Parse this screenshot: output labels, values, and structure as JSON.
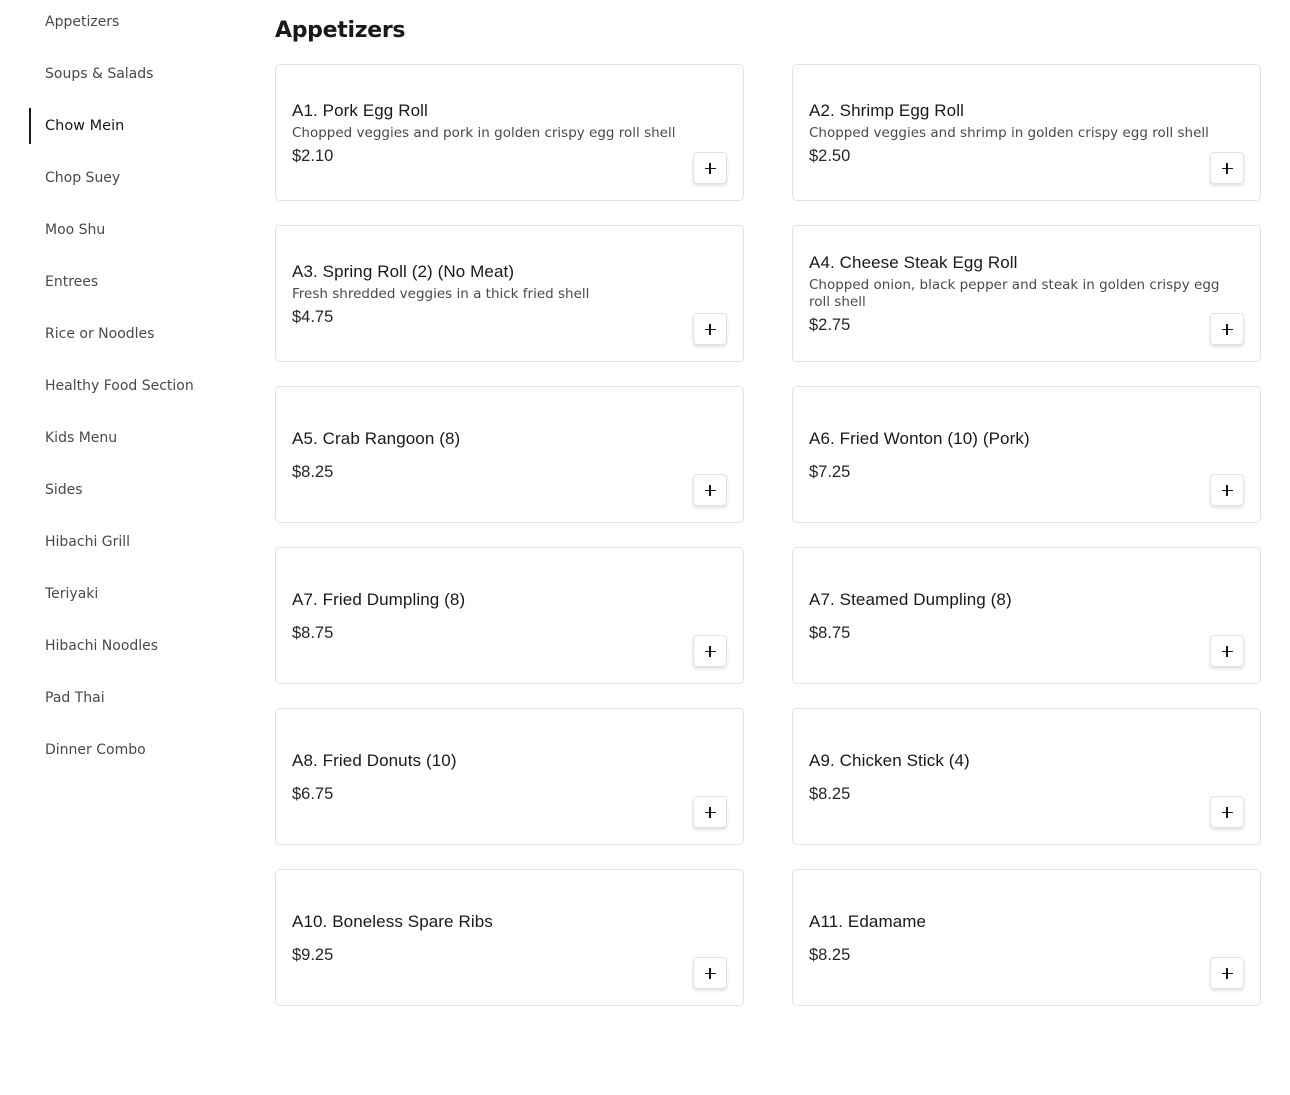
{
  "sidebar": {
    "items": [
      {
        "label": "Appetizers"
      },
      {
        "label": "Soups & Salads"
      },
      {
        "label": "Chow Mein",
        "active": true
      },
      {
        "label": "Chop Suey"
      },
      {
        "label": "Moo Shu"
      },
      {
        "label": "Entrees"
      },
      {
        "label": "Rice or Noodles"
      },
      {
        "label": "Healthy Food Section"
      },
      {
        "label": "Kids Menu"
      },
      {
        "label": "Sides"
      },
      {
        "label": "Hibachi Grill"
      },
      {
        "label": "Teriyaki"
      },
      {
        "label": "Hibachi Noodles"
      },
      {
        "label": "Pad Thai"
      },
      {
        "label": "Dinner Combo"
      }
    ]
  },
  "main": {
    "section_title": "Appetizers",
    "items": [
      {
        "name": "A1. Pork Egg Roll",
        "description": "Chopped veggies and pork in golden crispy egg roll shell",
        "price": "$2.10"
      },
      {
        "name": "A2. Shrimp Egg Roll",
        "description": "Chopped veggies and shrimp in golden crispy egg roll shell",
        "price": "$2.50"
      },
      {
        "name": "A3. Spring Roll (2) (No Meat)",
        "description": "Fresh shredded veggies in a thick fried shell",
        "price": "$4.75"
      },
      {
        "name": "A4. Cheese Steak Egg Roll",
        "description": "Chopped onion, black pepper and steak in golden crispy egg roll shell",
        "price": "$2.75"
      },
      {
        "name": "A5. Crab Rangoon (8)",
        "description": "",
        "price": "$8.25"
      },
      {
        "name": "A6. Fried Wonton (10) (Pork)",
        "description": "",
        "price": "$7.25"
      },
      {
        "name": "A7. Fried Dumpling (8)",
        "description": "",
        "price": "$8.75"
      },
      {
        "name": "A7. Steamed Dumpling (8)",
        "description": "",
        "price": "$8.75"
      },
      {
        "name": "A8. Fried Donuts (10)",
        "description": "",
        "price": "$6.75"
      },
      {
        "name": "A9. Chicken Stick (4)",
        "description": "",
        "price": "$8.25"
      },
      {
        "name": "A10. Boneless Spare Ribs",
        "description": "",
        "price": "$9.25"
      },
      {
        "name": "A11. Edamame",
        "description": "",
        "price": "$8.25"
      }
    ],
    "add_button_icon": "plus-icon"
  }
}
